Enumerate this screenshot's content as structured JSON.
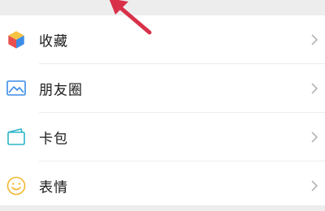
{
  "menu": {
    "items": [
      {
        "label": "收藏",
        "icon": "cube-icon"
      },
      {
        "label": "朋友圈",
        "icon": "image-icon"
      },
      {
        "label": "卡包",
        "icon": "wallet-icon"
      },
      {
        "label": "表情",
        "icon": "smiley-icon"
      }
    ]
  },
  "annotation": {
    "arrow_color": "#d9304a"
  }
}
